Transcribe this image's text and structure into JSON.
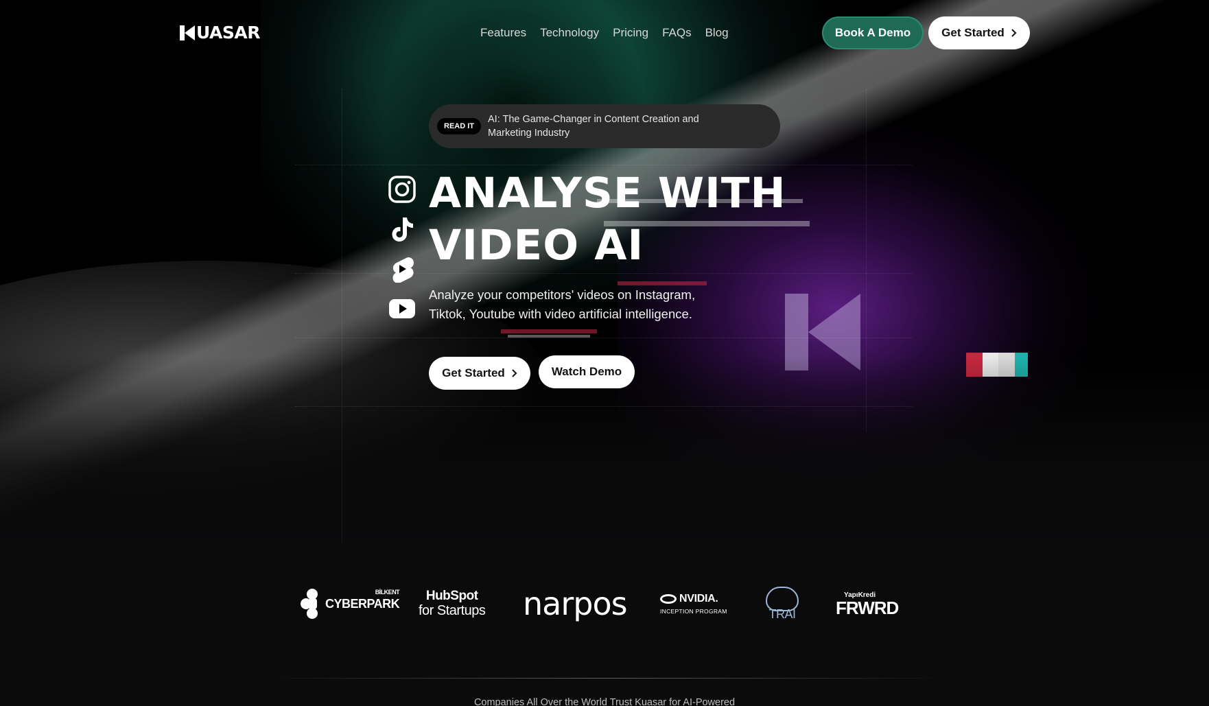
{
  "brand": {
    "name": "UASAR"
  },
  "nav": {
    "links": [
      "Features",
      "Technology",
      "Pricing",
      "FAQs",
      "Blog"
    ],
    "book_demo": "Book A Demo",
    "get_started": "Get Started"
  },
  "announcement": {
    "tag": "READ IT",
    "text": "AI: The Game-Changer in Content Creation and Marketing Industry"
  },
  "hero": {
    "title_line1": "ANALYSE WITH",
    "title_line2": "VIDEO AI",
    "subtitle": "Analyze your competitors' videos on Instagram, Tiktok, Youtube with video artificial intelligence.",
    "get_started": "Get Started",
    "watch_demo": "Watch Demo",
    "social_icons": [
      "instagram-icon",
      "tiktok-icon",
      "youtube-shorts-icon",
      "youtube-icon"
    ]
  },
  "partners": {
    "cyberpark": {
      "name": "CYBERPARK",
      "prefix": "BİLKENT"
    },
    "hubspot": {
      "line1": "HubSpot",
      "line2": "for Startups"
    },
    "narpos": {
      "name": "narpos"
    },
    "nvidia": {
      "name": "NVIDIA.",
      "sub": "INCEPTION PROGRAM"
    },
    "trai": {
      "name": "TRAI"
    },
    "frwrd": {
      "top": "YapıKredi",
      "name": "FRWRD"
    }
  },
  "trust_text": "Companies All Over the World Trust Kuasar for AI-Powered",
  "colors": {
    "accent_green": "#1f6a55",
    "background": "#0b0b0c",
    "button_light": "#ffffff"
  }
}
